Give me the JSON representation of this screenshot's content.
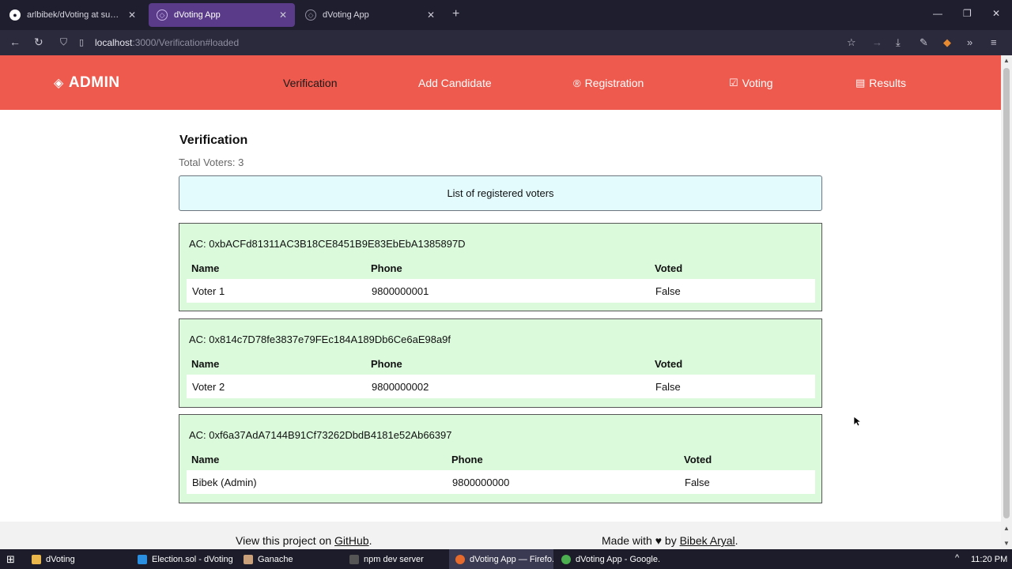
{
  "browser": {
    "tabs": [
      {
        "label": "arlbibek/dVoting at submitted",
        "icon": "github-icon"
      },
      {
        "label": "dVoting App",
        "icon": "dvoting-icon"
      },
      {
        "label": "dVoting App",
        "icon": "dvoting-icon"
      }
    ],
    "url_host": "localhost",
    "url_rest": ":3000/Verification#loaded"
  },
  "app": {
    "brand": "ADMIN",
    "menu": [
      {
        "label": "Verification",
        "icon": "",
        "active": true
      },
      {
        "label": "Add Candidate",
        "icon": "",
        "active": false
      },
      {
        "label": "Registration",
        "icon": "®",
        "active": false
      },
      {
        "label": "Voting",
        "icon": "vote-icon",
        "active": false
      },
      {
        "label": "Results",
        "icon": "results-icon",
        "active": false
      }
    ],
    "accent_color": "#ef5a4e"
  },
  "main": {
    "title": "Verification",
    "total_voters": "Total Voters: 3",
    "list_banner": "List of registered voters",
    "voters": [
      {
        "ac": "AC: 0xbACFd81311AC3B18CE8451B9E83EbEbA1385897D",
        "headers": [
          "Name",
          "Phone",
          "Voted"
        ],
        "name": "Voter 1",
        "phone": "9800000001",
        "voted": "False"
      },
      {
        "ac": "AC: 0x814c7D78fe3837e79FEc184A189Db6Ce6aE98a9f",
        "headers": [
          "Name",
          "Phone",
          "Voted"
        ],
        "name": "Voter 2",
        "phone": "9800000002",
        "voted": "False"
      },
      {
        "ac": "AC: 0xf6a37AdA7144B91Cf73262DbdB4181e52Ab66397",
        "headers": [
          "Name",
          "Phone",
          "Voted"
        ],
        "name": "Bibek (Admin)",
        "phone": "9800000000",
        "voted": "False"
      }
    ]
  },
  "footer": {
    "left_prefix": "View this project on ",
    "left_link": "GitHub",
    "left_suffix": ".",
    "right_prefix": "Made with ",
    "right_heart": "♥",
    "right_mid": " by ",
    "right_link": "Bibek Aryal",
    "right_suffix": "."
  },
  "taskbar": {
    "items": [
      {
        "label": "dVoting",
        "icon": "folder-icon",
        "color": "#e8b64a"
      },
      {
        "label": "Election.sol - dVoting ...",
        "icon": "vscode-icon",
        "color": "#2a8fe0"
      },
      {
        "label": "Ganache",
        "icon": "ganache-icon",
        "color": "#c9a07a"
      },
      {
        "label": "npm dev server",
        "icon": "terminal-icon",
        "color": "#333333"
      },
      {
        "label": "dVoting App — Firefo...",
        "icon": "firefox-icon",
        "color": "#e66a2c"
      },
      {
        "label": "dVoting App - Google...",
        "icon": "chrome-icon",
        "color": "#4caf50"
      }
    ],
    "clock": "11:20 PM"
  }
}
